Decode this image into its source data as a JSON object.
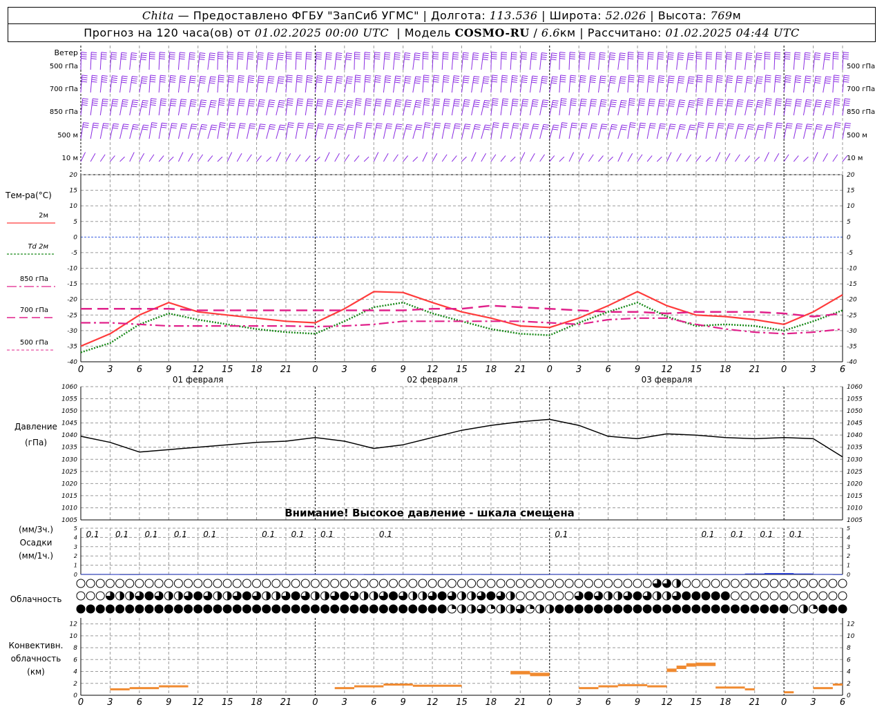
{
  "header": {
    "station": "Chita",
    "dash": "—",
    "provided_by": "Предоставлено ФГБУ \"ЗапСиб УГМС\"",
    "lon_label": "Долгота:",
    "lon_value": "113.536",
    "lat_label": "Широта:",
    "lat_value": "52.026",
    "alt_label": "Высота:",
    "alt_value": "769",
    "alt_unit": "м",
    "forecast_label": "Прогноз на 120 часа(ов) от",
    "forecast_start": "01.02.2025 00:00 UTC",
    "model_label": "Модель",
    "model_name": "COSMO-RU",
    "model_res": "6.6",
    "model_res_unit": "км",
    "computed_label": "Рассчитано:",
    "computed_value": "01.02.2025 04:44 UTC",
    "sep": "|"
  },
  "panels": {
    "wind": {
      "title": "Ветер",
      "levels": [
        "500 гПа",
        "700 гПа",
        "850 гПа",
        "500 м",
        "10 м"
      ],
      "color": "#8a2be2"
    },
    "temperature": {
      "title": "Тем-ра(°C)",
      "legend": [
        {
          "label": "2м",
          "color": "#ff3b3b",
          "style": "solid"
        },
        {
          "label": "Td 2м",
          "color": "#1a8a1a",
          "style": "dotted"
        },
        {
          "label": "850 гПа",
          "color": "#e0208a",
          "style": "dashdot"
        },
        {
          "label": "700 гПа",
          "color": "#e0208a",
          "style": "dash"
        },
        {
          "label": "500 гПа",
          "color": "#e0208a",
          "style": "fine"
        }
      ],
      "date_labels": [
        "01 февраля",
        "02 февраля",
        "03 февраля"
      ]
    },
    "pressure": {
      "title": "Давление",
      "unit": "(гПа)",
      "warning": "Внимание! Высокое давление - шкала смещена"
    },
    "precip": {
      "unit_top": "(мм/3ч.)",
      "title": "Осадки",
      "unit_bottom": "(мм/1ч.)",
      "labels": [
        "0.1",
        "0.1",
        "0.1",
        "0.1",
        "0.1",
        "0.1",
        "0.1",
        "0.1",
        "0.1",
        "0.1",
        "0.1",
        "0.1",
        "0.1",
        "0.1"
      ]
    },
    "cloud": {
      "title": "Облачность"
    },
    "convective": {
      "title": [
        "Конвективн.",
        "облачность",
        "(км)"
      ]
    }
  },
  "x_axis_labels": [
    "0",
    "3",
    "6",
    "9",
    "12",
    "15",
    "18",
    "21",
    "0",
    "3",
    "6",
    "9",
    "12",
    "15",
    "18",
    "21",
    "0",
    "3",
    "6",
    "9",
    "12",
    "15",
    "18",
    "21",
    "0",
    "3",
    "6"
  ],
  "chart_data": [
    {
      "type": "line",
      "name": "temperature",
      "x": [
        0,
        3,
        6,
        9,
        12,
        15,
        18,
        21,
        24,
        27,
        30,
        33,
        36,
        39,
        42,
        45,
        48,
        51,
        54,
        57,
        60,
        63,
        66,
        69,
        72,
        75,
        78
      ],
      "series": [
        {
          "name": "2м",
          "values": [
            -35,
            -31,
            -25,
            -21,
            -24,
            -25,
            -26,
            -27,
            -27.5,
            -23,
            -17.5,
            -17.8,
            -21,
            -24,
            -26,
            -28.5,
            -29,
            -26,
            -22,
            -17.5,
            -22,
            -25,
            -25.5,
            -26.5,
            -28,
            -24,
            -18.5
          ]
        },
        {
          "name": "Td 2м",
          "values": [
            -37,
            -34,
            -28,
            -24.5,
            -26.5,
            -28,
            -29.5,
            -30.5,
            -31,
            -27,
            -22.5,
            -21,
            -24.5,
            -27,
            -29.5,
            -31,
            -31.5,
            -27.5,
            -24,
            -21,
            -25.5,
            -28.5,
            -28,
            -28.5,
            -30,
            -27,
            -23.5
          ]
        },
        {
          "name": "850 гПа",
          "values": [
            -27.5,
            -27.5,
            -28,
            -28.5,
            -28.5,
            -28.5,
            -28.5,
            -28.5,
            -28.7,
            -28.5,
            -28,
            -27,
            -27,
            -27,
            -27,
            -27,
            -27.5,
            -28,
            -26.5,
            -26,
            -26,
            -28,
            -29.5,
            -30.5,
            -31,
            -30.5,
            -29.5
          ]
        },
        {
          "name": "700 гПа",
          "values": [
            -23,
            -23,
            -23,
            -23,
            -23.5,
            -23.5,
            -23.5,
            -23.5,
            -23.5,
            -23.5,
            -23.5,
            -23.5,
            -23,
            -23,
            -22,
            -22.5,
            -23,
            -23.5,
            -24,
            -24,
            -24.5,
            -24,
            -24,
            -24,
            -24.5,
            -25.5,
            -24.5
          ]
        }
      ],
      "ylim": [
        -40,
        20
      ],
      "yticks": [
        -40,
        -35,
        -30,
        -25,
        -20,
        -15,
        -10,
        -5,
        0,
        5,
        10,
        15,
        20
      ],
      "grid": true
    },
    {
      "type": "line",
      "name": "pressure",
      "x": [
        0,
        3,
        6,
        9,
        12,
        15,
        18,
        21,
        24,
        27,
        30,
        33,
        36,
        39,
        42,
        45,
        48,
        51,
        54,
        57,
        60,
        63,
        66,
        69,
        72,
        75,
        78
      ],
      "series": [
        {
          "name": "Давление",
          "values": [
            1039.5,
            1037,
            1033,
            1034,
            1035,
            1036,
            1037,
            1037.5,
            1039,
            1037.5,
            1034.5,
            1036,
            1039,
            1042,
            1044,
            1045.5,
            1046.5,
            1044,
            1039.5,
            1038.5,
            1040.5,
            1040,
            1039,
            1038.5,
            1039,
            1038.5,
            1031
          ]
        }
      ],
      "ylim": [
        1005,
        1060
      ],
      "yticks": [
        1005,
        1010,
        1015,
        1020,
        1025,
        1030,
        1035,
        1040,
        1045,
        1050,
        1055,
        1060
      ],
      "grid": true
    },
    {
      "type": "bar",
      "name": "precipitation",
      "x": [
        0,
        1,
        2,
        3,
        4,
        5,
        6,
        7,
        8,
        9,
        10,
        11,
        12,
        13,
        14,
        15,
        16,
        17,
        18,
        19,
        20,
        21,
        22,
        23,
        24,
        25,
        26,
        27,
        28,
        29,
        30,
        31,
        32,
        33,
        34,
        35,
        36,
        37,
        38,
        39,
        40,
        41,
        42,
        43,
        44,
        45,
        46,
        47,
        48,
        49,
        50,
        51,
        52,
        53,
        54,
        55,
        56,
        57,
        58,
        59,
        60,
        61,
        62,
        63,
        64,
        65,
        66,
        67,
        68,
        69,
        70,
        71,
        72,
        73,
        74,
        75,
        76,
        77,
        78
      ],
      "series": [
        {
          "name": "мм/1ч",
          "values": [
            0.05,
            0.05,
            0.05,
            0.03,
            0.02,
            0.02,
            0.05,
            0.05,
            0.05,
            0.05,
            0.05,
            0.03,
            0.05,
            0.05,
            0.05,
            0.02,
            0.02,
            0.02,
            0.02,
            0.02,
            0.05,
            0.02,
            0.05,
            0.05,
            0.05,
            0.05,
            0.05,
            0.05,
            0.03,
            0.02,
            0.02,
            0.05,
            0.05,
            0.05,
            0.05,
            0.02,
            0.02,
            0.02,
            0.02,
            0.03,
            0.05,
            0.02,
            0.02,
            0.02,
            0.02,
            0.02,
            0.02,
            0.02,
            0.05,
            0.05,
            0.02,
            0.02,
            0.02,
            0.02,
            0.02,
            0.02,
            0.05,
            0.02,
            0.02,
            0.02,
            0.02,
            0.02,
            0.02,
            0.02,
            0.02,
            0.02,
            0.02,
            0.02,
            0.1,
            0.1,
            0.15,
            0.15,
            0.15,
            0.1,
            0.1,
            0.05,
            0.05,
            0.02,
            0.02
          ]
        }
      ],
      "label_x_hours": [
        1,
        4,
        7,
        10,
        13,
        19,
        22,
        25,
        31,
        49,
        64,
        67,
        70,
        73
      ],
      "ylim": [
        0,
        5
      ],
      "yticks": [
        0,
        1,
        2,
        3,
        4,
        5
      ]
    },
    {
      "type": "bar",
      "name": "convective_cloud",
      "segments_hours": [
        [
          3,
          5,
          1.0
        ],
        [
          5,
          8,
          1.2
        ],
        [
          8,
          11,
          1.5
        ],
        [
          26,
          28,
          1.2
        ],
        [
          28,
          31,
          1.5
        ],
        [
          31,
          34,
          1.8
        ],
        [
          34,
          39,
          1.6
        ],
        [
          44,
          46,
          3.8
        ],
        [
          46,
          48,
          3.5
        ],
        [
          51,
          53,
          1.2
        ],
        [
          53,
          55,
          1.5
        ],
        [
          55,
          58,
          1.7
        ],
        [
          58,
          60,
          1.5
        ],
        [
          60,
          61,
          4.2
        ],
        [
          61,
          62,
          4.7
        ],
        [
          62,
          63,
          5.1
        ],
        [
          63,
          65,
          5.2
        ],
        [
          65,
          68,
          1.3
        ],
        [
          68,
          69,
          1.0
        ],
        [
          72,
          73,
          0.5
        ],
        [
          75,
          77,
          1.2
        ],
        [
          77,
          78,
          1.8
        ]
      ],
      "ylim": [
        0,
        13
      ],
      "yticks": [
        0,
        2,
        4,
        6,
        8,
        10,
        12
      ]
    }
  ]
}
